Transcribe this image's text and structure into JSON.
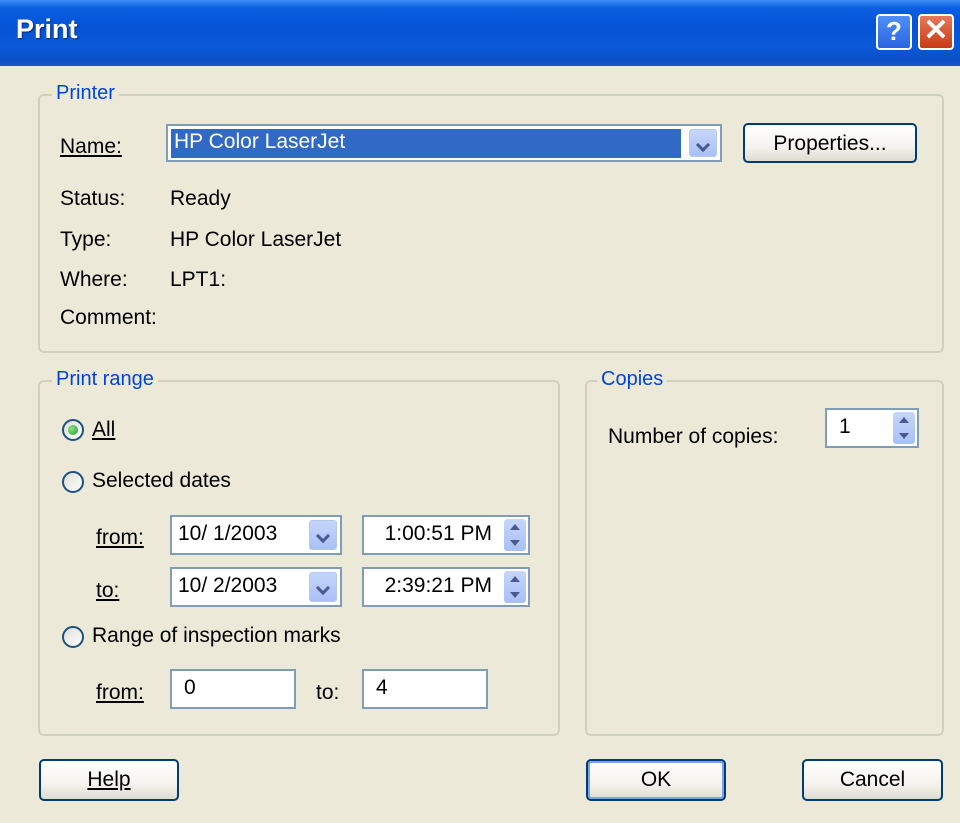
{
  "window": {
    "title": "Print"
  },
  "titlebar": {
    "help_icon": "question-icon",
    "close_icon": "close-icon"
  },
  "printer": {
    "legend": "Printer",
    "name_label": "Name:",
    "name_value": "HP Color LaserJet",
    "properties_label": "Properties...",
    "status_label": "Status:",
    "status_value": "Ready",
    "type_label": "Type:",
    "type_value": "HP Color LaserJet",
    "where_label": "Where:",
    "where_value": "LPT1:",
    "comment_label": "Comment:",
    "comment_value": ""
  },
  "print_range": {
    "legend": "Print range",
    "all_label": "All",
    "all_checked": true,
    "selected_dates_label": "Selected dates",
    "from_label": "from:",
    "from_date": "10/ 1/2003",
    "from_time": "1:00:51 PM",
    "to_label": "to:",
    "to_date": "10/ 2/2003",
    "to_time": "2:39:21 PM",
    "marks_label": "Range of inspection marks",
    "marks_from_label": "from:",
    "marks_from_value": "0",
    "marks_to_label": "to:",
    "marks_to_value": "4"
  },
  "copies": {
    "legend": "Copies",
    "number_label": "Number of copies:",
    "number_value": "1"
  },
  "buttons": {
    "help": "Help",
    "ok": "OK",
    "cancel": "Cancel"
  },
  "colors": {
    "title_bar": "#0553d6",
    "group_legend": "#0046d5",
    "selection": "#316ac5",
    "face": "#ece9d8"
  }
}
